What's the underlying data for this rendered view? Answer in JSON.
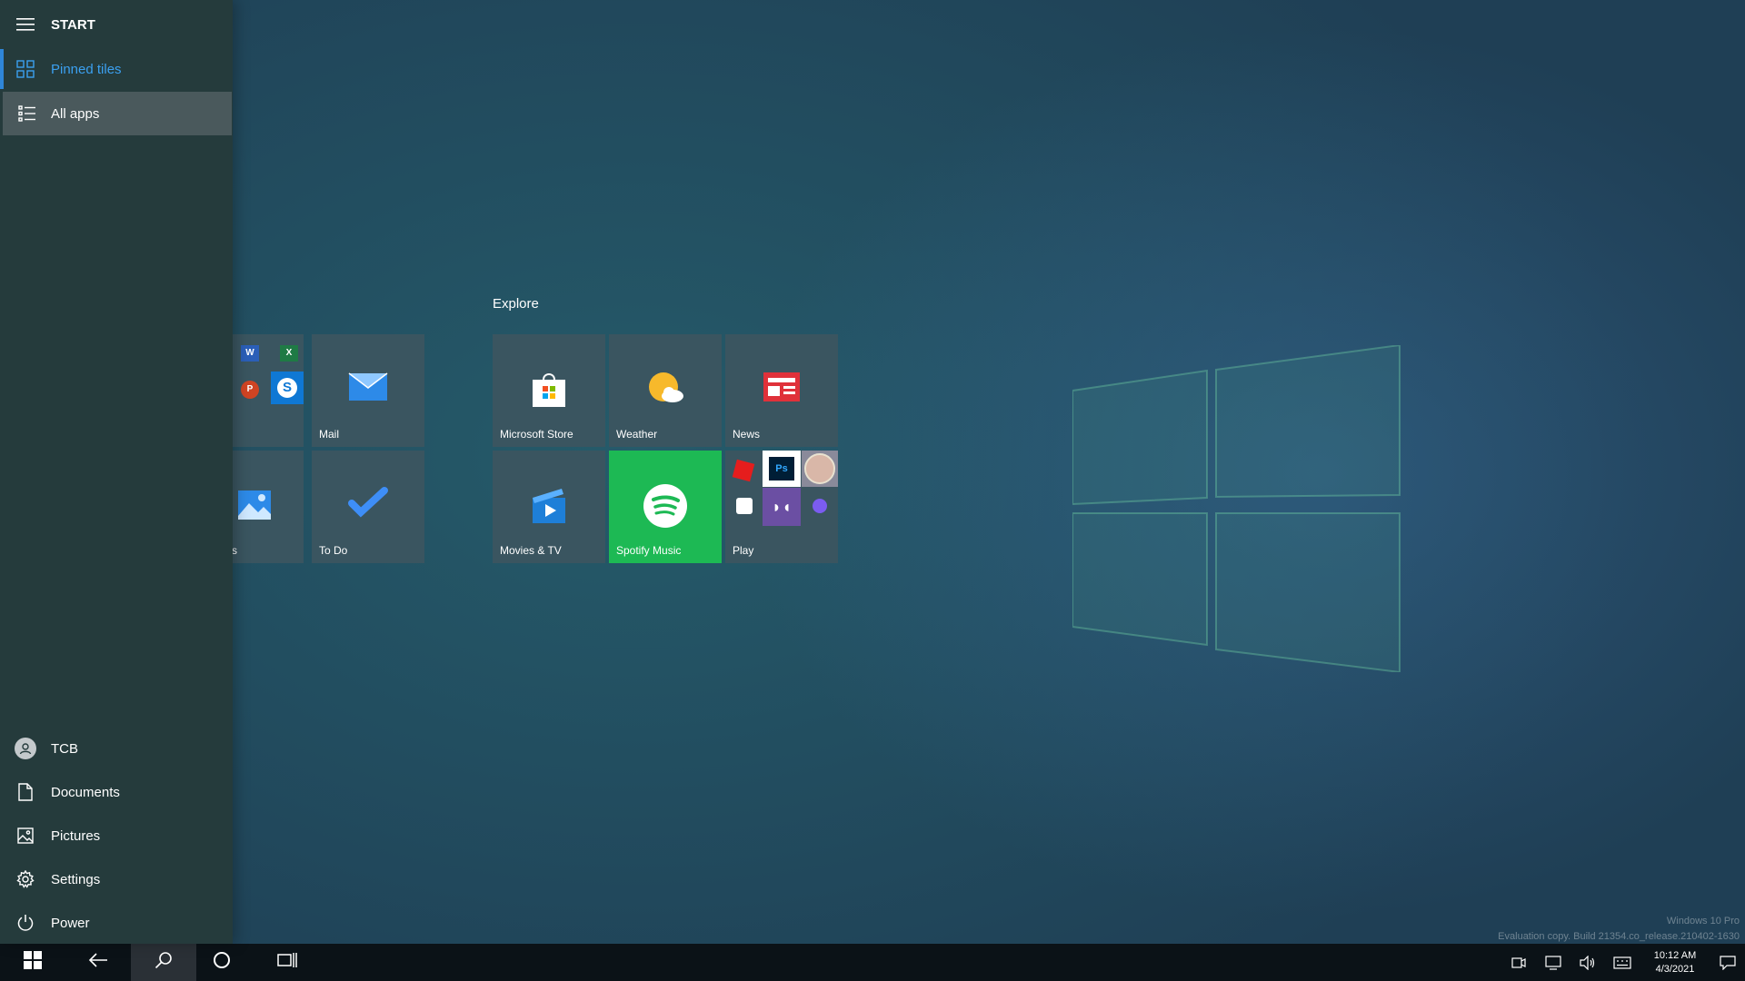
{
  "start": {
    "header": "START",
    "pinned_tiles": "Pinned tiles",
    "all_apps": "All apps",
    "user": "TCB",
    "documents": "Documents",
    "pictures": "Pictures",
    "settings": "Settings",
    "power": "Power"
  },
  "tiles": {
    "group_title": "Explore",
    "mail": "Mail",
    "photos_partial": "s",
    "todo": "To Do",
    "store": "Microsoft Store",
    "weather": "Weather",
    "news": "News",
    "movies": "Movies & TV",
    "spotify": "Spotify Music",
    "play": "Play"
  },
  "taskbar": {
    "time": "10:12 AM",
    "date": "4/3/2021"
  },
  "watermark": {
    "line1": "Windows 10 Pro",
    "line2": "Evaluation copy. Build 21354.co_release.210402-1630"
  },
  "colors": {
    "accent": "#2f86d8",
    "spotify": "#1db954",
    "tile_bg": "#3a5560",
    "sidebar_bg": "#253b3c"
  },
  "icons": [
    "hamburger-icon",
    "pinned-tiles-icon",
    "all-apps-icon",
    "user-icon",
    "documents-icon",
    "pictures-icon",
    "settings-icon",
    "power-icon",
    "windows-icon",
    "back-icon",
    "search-icon",
    "cortana-icon",
    "task-view-icon"
  ]
}
